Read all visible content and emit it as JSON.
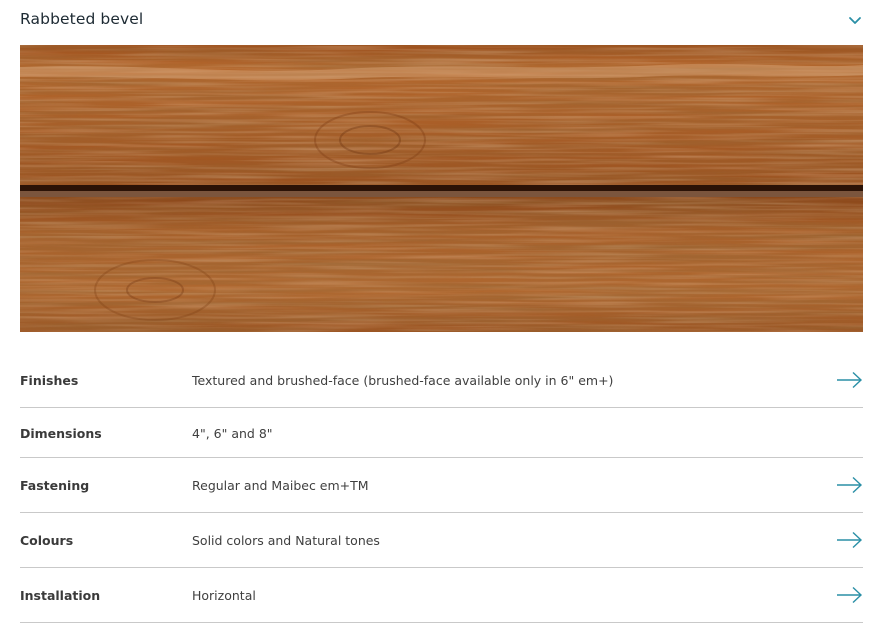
{
  "section": {
    "title": "Rabbeted bevel",
    "toggle_icon": "chevron-down-icon",
    "image_subject": "wood-siding-image"
  },
  "specs": [
    {
      "label": "Finishes",
      "value": "Textured and brushed-face (brushed-face available only in 6\" em+)",
      "has_link": true
    },
    {
      "label": "Dimensions",
      "value": "4\", 6\" and 8\"",
      "has_link": false
    },
    {
      "label": "Fastening",
      "value": "Regular and Maibec em+TM",
      "has_link": true
    },
    {
      "label": "Colours",
      "value": "Solid colors and Natural tones",
      "has_link": true
    },
    {
      "label": "Installation",
      "value": "Horizontal",
      "has_link": true
    }
  ],
  "colors": {
    "accent": "#2a8fa6",
    "divider": "#c9c9c9",
    "wood_light": "#b0642a",
    "wood_dark": "#7a3b14"
  }
}
